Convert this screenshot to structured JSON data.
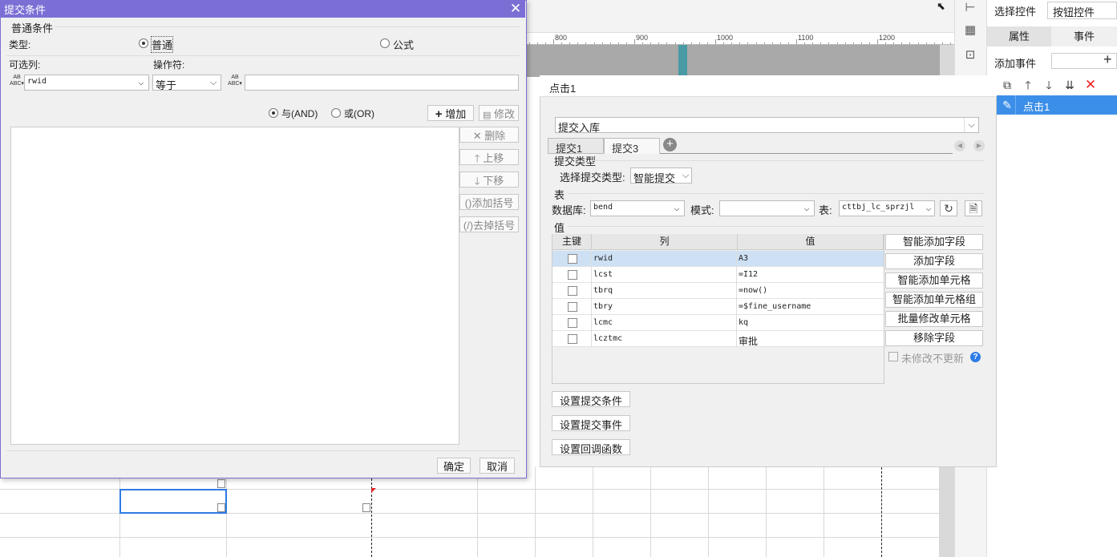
{
  "designer": {
    "ruler_labels": [
      "800",
      "900",
      "1000",
      "1100",
      "1200"
    ],
    "right_panel": {
      "select_control_label": "选择控件",
      "select_control_value": "按钮控件",
      "tabs": [
        "属性",
        "事件"
      ],
      "add_event_label": "添加事件",
      "event_item": "点击1"
    }
  },
  "submit_condition_dialog": {
    "title": "提交条件",
    "group_label": "普通条件",
    "type_label": "类型:",
    "type_options": [
      "普通",
      "公式"
    ],
    "type_selected": "普通",
    "column_label": "可选列:",
    "operator_label": "操作符:",
    "column_value": "rwid",
    "operator_value": "等于",
    "value_input": "",
    "logic_options": [
      "与(AND)",
      "或(OR)"
    ],
    "logic_selected": "与(AND)",
    "add_button": "增加",
    "modify_button": "修改",
    "side_buttons": [
      "删除",
      "上移",
      "下移",
      "添加括号",
      "去掉括号"
    ],
    "ok_button": "确定",
    "cancel_button": "取消"
  },
  "action_panel": {
    "header": "点击1",
    "action_type": "提交入库",
    "tabs": [
      "提交1",
      "提交3"
    ],
    "active_tab": "提交1",
    "submit_type_section": "提交类型",
    "submit_type_label": "选择提交类型:",
    "submit_type_value": "智能提交",
    "table_section": "表",
    "db_label": "数据库:",
    "db_value": "bend",
    "schema_label": "模式:",
    "schema_value": "",
    "table_label": "表:",
    "table_value": "cttbj_lc_sprzjl",
    "value_section": "值",
    "columns": [
      "主键",
      "列",
      "值"
    ],
    "rows": [
      {
        "column": "rwid",
        "value": "A3",
        "selected": true
      },
      {
        "column": "lcst",
        "value": "=I12",
        "selected": false
      },
      {
        "column": "tbrq",
        "value": "=now()",
        "selected": false
      },
      {
        "column": "tbry",
        "value": "=$fine_username",
        "selected": false
      },
      {
        "column": "lcmc",
        "value": "kq",
        "selected": false
      },
      {
        "column": "lcztmc",
        "value": "审批",
        "selected": false
      }
    ],
    "side_buttons": [
      "智能添加字段",
      "添加字段",
      "智能添加单元格",
      "智能添加单元格组",
      "批量修改单元格",
      "移除字段"
    ],
    "no_update_label": "未修改不更新",
    "bottom_buttons": [
      "设置提交条件",
      "设置提交事件",
      "设置回调函数"
    ]
  }
}
